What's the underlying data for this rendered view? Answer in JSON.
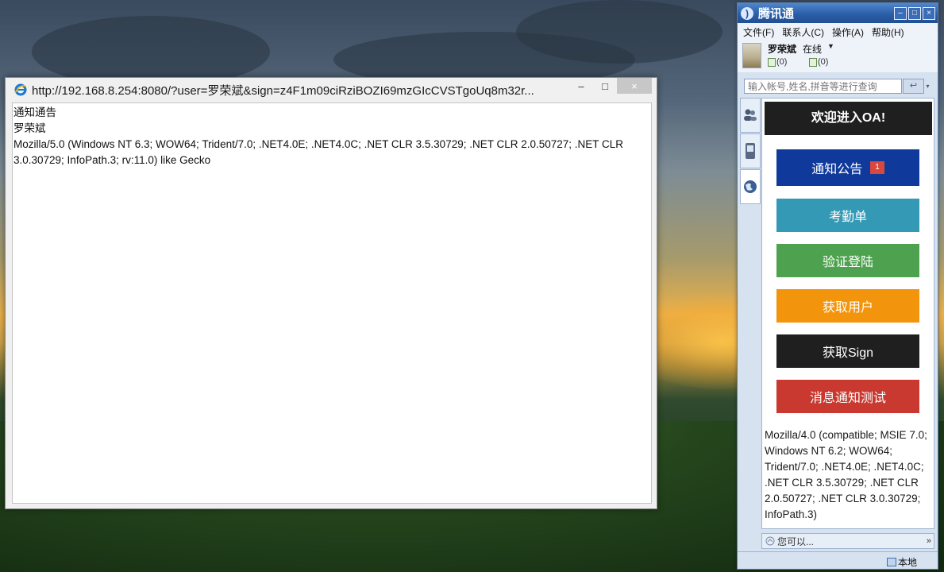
{
  "ie_window": {
    "title": "http://192.168.8.254:8080/?user=罗荣斌&sign=z4F1m09ciRziBOZI69mzGIcCVSTgoUq8m32r...",
    "controls": {
      "minimize": "–",
      "maximize": "□",
      "close": "×"
    },
    "content": {
      "line1": "通知通告",
      "line2": "罗荣斌",
      "line3": "Mozilla/5.0 (Windows NT 6.3; WOW64; Trident/7.0; .NET4.0E; .NET4.0C; .NET CLR 3.5.30729; .NET CLR 2.0.50727; .NET CLR 3.0.30729; InfoPath.3; rv:11.0) like Gecko"
    }
  },
  "rtx": {
    "title": "腾讯通",
    "controls": {
      "minimize": "–",
      "maximize": "□",
      "close": "×"
    },
    "menu": [
      "文件(F)",
      "联系人(C)",
      "操作(A)",
      "帮助(H)"
    ],
    "user": {
      "name": "罗荣斌",
      "status": "在线",
      "status_arrow": "▼",
      "counter1": "(0)",
      "counter2": "(0)"
    },
    "search": {
      "placeholder": "输入帐号,姓名,拼音等进行查询",
      "button": "↩",
      "dropdown": "▾"
    },
    "oa": {
      "header": "欢迎进入OA!",
      "buttons": [
        {
          "label": "通知公告",
          "badge": "1",
          "color": "#0f3a9c"
        },
        {
          "label": "考勤单",
          "color": "#3399b5"
        },
        {
          "label": "验证登陆",
          "color": "#4ea24f"
        },
        {
          "label": "获取用户",
          "color": "#f2950d"
        },
        {
          "label": "获取Sign",
          "color": "#1f1f1f"
        },
        {
          "label": "消息通知测试",
          "color": "#c9392f"
        }
      ],
      "user_agent": "Mozilla/4.0 (compatible; MSIE 7.0; Windows NT 6.2; WOW64; Trident/7.0; .NET4.0E; .NET4.0C; .NET CLR 3.5.30729; .NET CLR 2.0.50727; .NET CLR 3.0.30729; InfoPath.3)"
    },
    "bottom": {
      "label": "您可以...",
      "more": "»"
    },
    "statusbar": {
      "local": "本地"
    }
  }
}
